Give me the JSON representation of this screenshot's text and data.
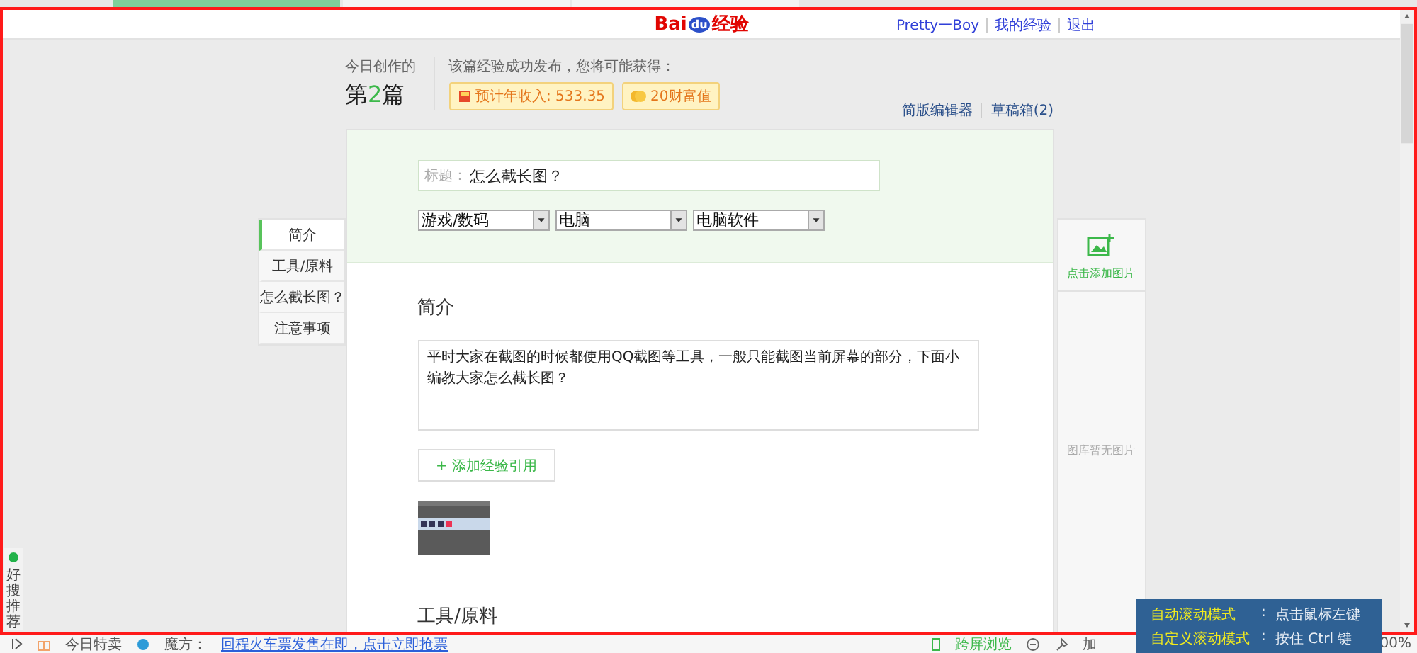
{
  "header": {
    "logo": {
      "latin": "Bai",
      "paw": "du",
      "cjk": "经验"
    },
    "user_links": [
      "Pretty一Boy",
      "我的经验",
      "退出"
    ]
  },
  "stats": {
    "today_label": "今日创作的",
    "count": {
      "prefix": "第",
      "number": "2",
      "suffix": "篇"
    },
    "reward_label": "该篇经验成功发布，您将可能获得：",
    "badges": [
      {
        "kind": "income",
        "text": "预计年收入: 533.35"
      },
      {
        "kind": "wealth",
        "text": "20财富值"
      }
    ]
  },
  "editor_links": [
    "简版编辑器",
    "草稿箱(2)"
  ],
  "form": {
    "title_label": "标题：",
    "title_value": "怎么截长图？",
    "selects": [
      "游戏/数码",
      "电脑",
      "电脑软件"
    ]
  },
  "nav": [
    {
      "label": "简介",
      "selected": true
    },
    {
      "label": "工具/原料",
      "selected": false
    },
    {
      "label": "怎么截长图？",
      "selected": false
    },
    {
      "label": "注意事项",
      "selected": false
    }
  ],
  "sections": [
    {
      "heading": "简介",
      "text": "平时大家在截图的时候都使用QQ截图等工具，一般只能截图当前屏幕的部分，下面小编教大家怎么截长图？",
      "add_button": "+ 添加经验引用"
    },
    {
      "heading": "工具/原料"
    }
  ],
  "image_panel": {
    "add_label": "点击添加图片",
    "empty_label": "图库暂无图片"
  },
  "side_widget": {
    "label": "好搜推荐"
  },
  "status_bar": {
    "items": [
      "今日特卖",
      "魔方："
    ],
    "link": "回程火车票发售在即，点击立即抢票",
    "right_items": [
      "跨屏浏览",
      "加"
    ],
    "zoom": "00%"
  },
  "scroll_popup": [
    {
      "mode": "自动滚动模式",
      "sep": ":",
      "action": "点击鼠标左键"
    },
    {
      "mode": "自定义滚动模式",
      "sep": ":",
      "action": "按住 Ctrl 键"
    }
  ]
}
